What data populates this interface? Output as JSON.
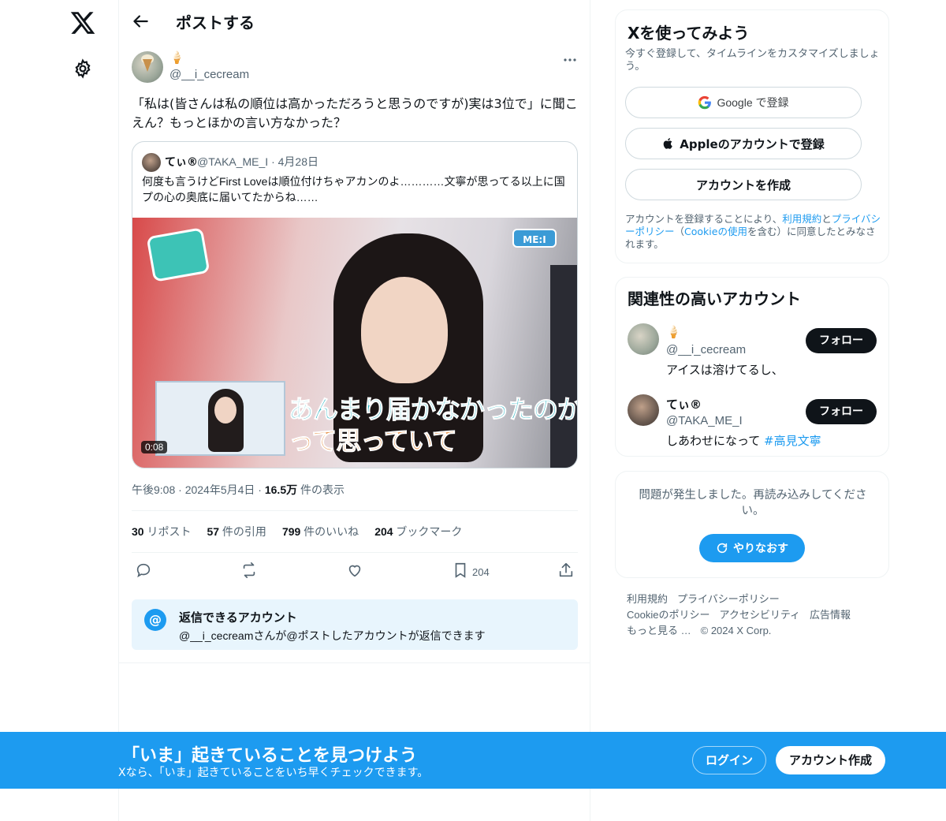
{
  "header": {
    "title": "ポストする"
  },
  "post": {
    "author_name": "🍦",
    "author_handle": "@__i_cecream",
    "text": "「私は(皆さんは私の順位は高かっただろうと思うのですが)実は3位で」に聞こえん？もっとほかの言い方なかった？",
    "quote": {
      "name": "てぃ®",
      "meta": "@TAKA_ME_I · 4月28日",
      "text": "何度も言うけどFirst Loveは順位付けちゃアカンのよ…………文寧が思ってる以上に国プの心の奥底に届いてたからね……",
      "video_duration": "0:08",
      "caption_line1": "あんまり届かなかったのかな",
      "caption_line2": "って思っていて",
      "broadcaster_badge": "ME:I"
    },
    "timestamp": "午後9:08 · 2024年5月4日 · ",
    "views_count": "16.5万",
    "views_label": " 件の表示",
    "stats": [
      {
        "count": "30",
        "label": " リポスト"
      },
      {
        "count": "57",
        "label": " 件の引用"
      },
      {
        "count": "799",
        "label": " 件のいいね"
      },
      {
        "count": "204",
        "label": " ブックマーク"
      }
    ],
    "bookmark_count": "204",
    "reply_restriction": {
      "title": "返信できるアカウント",
      "subtitle": "@__i_cecreamさんが@ポストしたアカウントが返信できます"
    }
  },
  "signup": {
    "title": "Xを使ってみよう",
    "subtitle": "今すぐ登録して、タイムラインをカスタマイズしましょう。",
    "google_label": "Google で登録",
    "apple_label": "Appleのアカウントで登録",
    "create_label": "アカウントを作成",
    "terms_prefix": "アカウントを登録することにより、",
    "terms_link1": "利用規約",
    "terms_and": "と",
    "terms_link2": "プライバシーポリシー",
    "terms_mid": "（",
    "terms_link3": "Cookieの使用",
    "terms_suffix": "を含む）に同意したとみなされます。"
  },
  "related": {
    "title": "関連性の高いアカウント",
    "accounts": [
      {
        "name": "🍦",
        "handle": "@__i_cecream",
        "bio": "アイスは溶けてるし、",
        "bio_tag": "",
        "follow_label": "フォロー"
      },
      {
        "name": "てぃ®",
        "handle": "@TAKA_ME_I",
        "bio": "しあわせになって ",
        "bio_tag": "#高見文寧",
        "follow_label": "フォロー"
      }
    ]
  },
  "error": {
    "message": "問題が発生しました。再読み込みしてください。",
    "retry_label": "やりなおす"
  },
  "footer": {
    "links": [
      "利用規約",
      "プライバシーポリシー",
      "Cookieのポリシー",
      "アクセシビリティ",
      "広告情報",
      "もっと見る …",
      "© 2024 X Corp."
    ]
  },
  "bottom_bar": {
    "title": "「いま」起きていることを見つけよう",
    "subtitle": "Xなら、「いま」起きていることをいち早くチェックできます。",
    "login_label": "ログイン",
    "signup_label": "アカウント作成"
  },
  "colors": {
    "accent": "#1d9bf0",
    "text_primary": "#0f1419",
    "text_secondary": "#536471",
    "border": "#eff3f4"
  }
}
